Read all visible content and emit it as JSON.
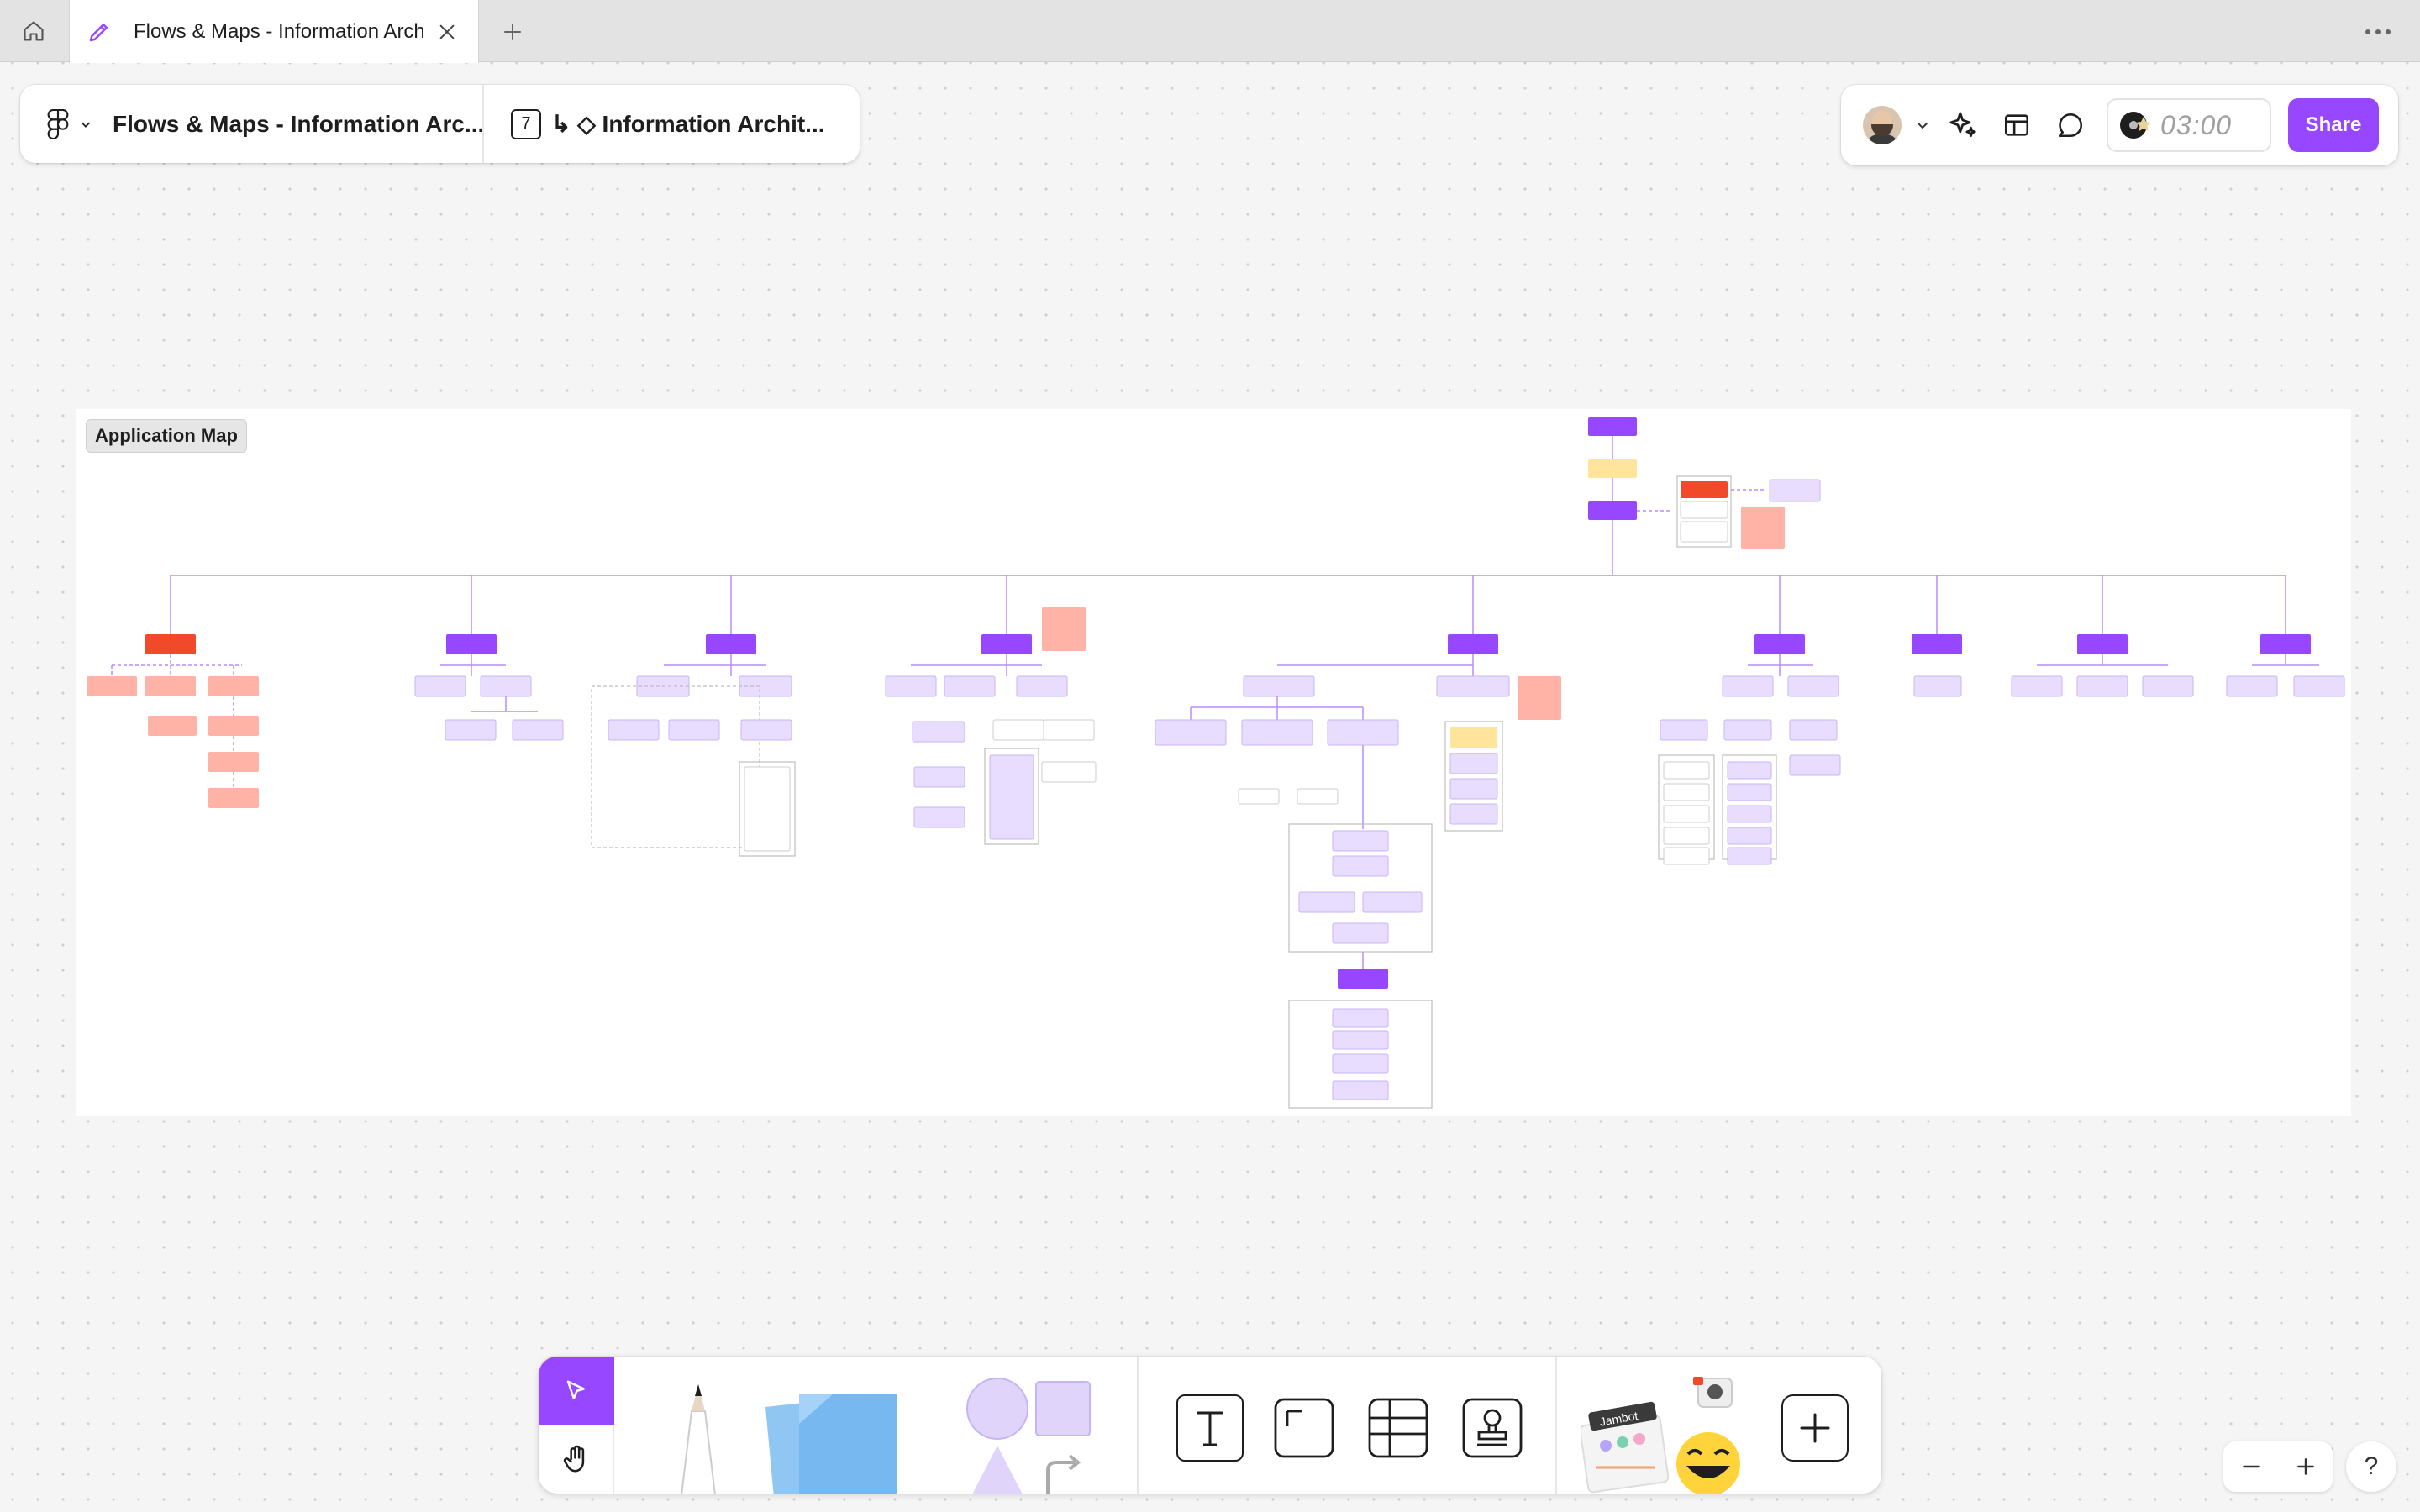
{
  "tab": {
    "title": "Flows & Maps - Information Architecture"
  },
  "toolbar": {
    "file_name": "Flows & Maps - Information Arc...",
    "page_number": "7",
    "page_name": "↳ ◇ Information Archit..."
  },
  "right_bar": {
    "timer": "03:00",
    "share_label": "Share"
  },
  "section": {
    "label": "Application Map"
  },
  "colors": {
    "accent": "#9747ff",
    "node_purple": "#9747ff",
    "node_light": "#e9ddff",
    "node_red": "#f04a2b",
    "node_salmon": "#ffb3a7",
    "node_yellow": "#ffe49b",
    "connector": "#b88cff"
  },
  "icons": {
    "home": "home-icon",
    "tab": "pencil-icon",
    "close": "close-icon",
    "new_tab": "plus-icon",
    "more": "more-icon",
    "figma": "figma-logo-icon",
    "ai": "sparkle-icon",
    "layout": "layout-icon",
    "chat": "comment-icon",
    "select": "cursor-icon",
    "hand": "hand-icon",
    "text": "text-icon",
    "frame": "frame-icon",
    "table": "table-icon",
    "stamp": "stamp-icon"
  },
  "zoom": {
    "minus": "−",
    "plus": "+"
  },
  "help": "?"
}
